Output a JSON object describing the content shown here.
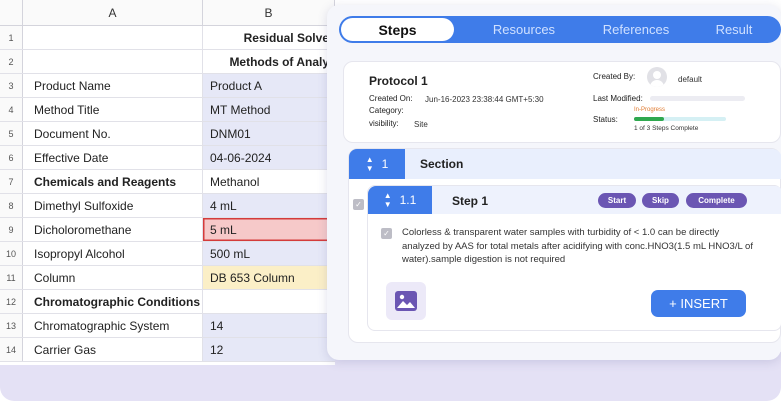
{
  "sheet": {
    "columns": [
      "A",
      "B"
    ],
    "rows": [
      {
        "n": "1",
        "a": "",
        "b": "Residual Solve"
      },
      {
        "n": "2",
        "a": "",
        "b": "Methods of Analy"
      },
      {
        "n": "3",
        "a": "Product Name",
        "b": "Product A"
      },
      {
        "n": "4",
        "a": "Method Title",
        "b": "MT Method"
      },
      {
        "n": "5",
        "a": "Document No.",
        "b": "DNM01"
      },
      {
        "n": "6",
        "a": "Effective Date",
        "b": "04-06-2024"
      },
      {
        "n": "7",
        "a": "Chemicals and Reagents",
        "b": "Methanol"
      },
      {
        "n": "8",
        "a": "Dimethyl Sulfoxide",
        "b": "4 mL"
      },
      {
        "n": "9",
        "a": "Dicholoromethane",
        "b": "5 mL"
      },
      {
        "n": "10",
        "a": "Isopropyl Alcohol",
        "b": "500 mL"
      },
      {
        "n": "11",
        "a": "Column",
        "b": "DB 653 Column"
      },
      {
        "n": "12",
        "a": "Chromatographic Conditions",
        "b": ""
      },
      {
        "n": "13",
        "a": "Chromatographic System",
        "b": "14"
      },
      {
        "n": "14",
        "a": "Carrier Gas",
        "b": "12"
      }
    ]
  },
  "tabs": [
    "Steps",
    "Resources",
    "References",
    "Result"
  ],
  "protocol": {
    "title": "Protocol 1",
    "created_on_label": "Created On:",
    "created_on": "Jun-16-2023 23:38:44 GMT+5:30",
    "category_label": "Category:",
    "visibility_label": "visibility:",
    "visibility": "Site",
    "created_by_label": "Created By:",
    "created_by": "default",
    "last_modified_label": "Last Modified:",
    "status_label": "Status:",
    "status_text": "In-Progress",
    "progress_caption": "1 of 3 Steps Complete",
    "progress_fraction": 0.33
  },
  "section": {
    "number": "1",
    "title": "Section"
  },
  "step": {
    "number": "1.1",
    "title": "Step 1",
    "actions": [
      "Start",
      "Skip",
      "Complete"
    ],
    "instruction": "Colorless & transparent water samples with turbidity of < 1.0 can be directly analyzed by AAS for total metals after acidifying with conc.HNO3(1.5 mL HNO3/L of water).sample digestion is not  required",
    "insert_label": "+ INSERT"
  },
  "colors": {
    "accent": "#3f7ce9",
    "pill": "#6b56b3",
    "highlight_red": "#f6c9c9",
    "highlight_yellow": "#fbefc7",
    "progress": "#2fa84f"
  }
}
